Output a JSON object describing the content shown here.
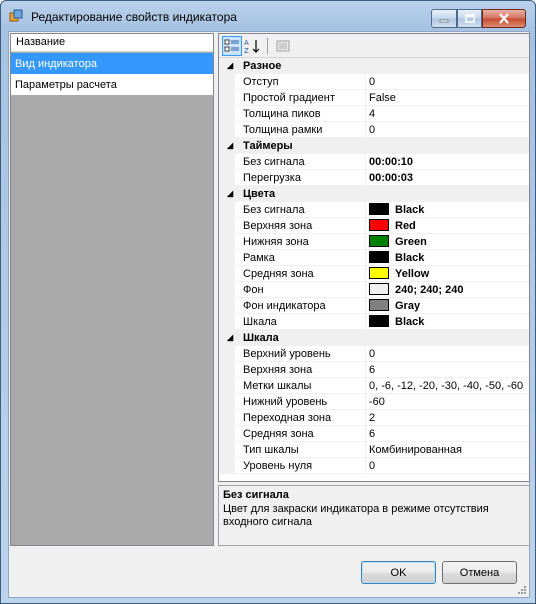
{
  "window": {
    "title": "Редактирование свойств индикатора"
  },
  "left_list": {
    "header": "Название",
    "items": [
      "Вид индикатора",
      "Параметры расчета"
    ]
  },
  "categories": [
    {
      "name": "Разное",
      "props": [
        {
          "name": "Отступ",
          "value": "0"
        },
        {
          "name": "Простой градиент",
          "value": "False"
        },
        {
          "name": "Толщина пиков",
          "value": "4"
        },
        {
          "name": "Толщина рамки",
          "value": "0"
        }
      ]
    },
    {
      "name": "Таймеры",
      "props": [
        {
          "name": "Без сигнала",
          "value": "00:00:10"
        },
        {
          "name": "Перегрузка",
          "value": "00:00:03"
        }
      ]
    },
    {
      "name": "Цвета",
      "props": [
        {
          "name": "Без сигнала",
          "value": "Black",
          "color": "#000000"
        },
        {
          "name": "Верхняя зона",
          "value": "Red",
          "color": "#ff0000"
        },
        {
          "name": "Нижняя зона",
          "value": "Green",
          "color": "#008000"
        },
        {
          "name": "Рамка",
          "value": "Black",
          "color": "#000000"
        },
        {
          "name": "Средняя зона",
          "value": "Yellow",
          "color": "#ffff00"
        },
        {
          "name": "Фон",
          "value": "240; 240; 240",
          "color": "#f0f0f0"
        },
        {
          "name": "Фон индикатора",
          "value": "Gray",
          "color": "#808080"
        },
        {
          "name": "Шкала",
          "value": "Black",
          "color": "#000000"
        }
      ]
    },
    {
      "name": "Шкала",
      "props": [
        {
          "name": "Верхний уровень",
          "value": "0"
        },
        {
          "name": "Верхняя зона",
          "value": "6"
        },
        {
          "name": "Метки шкалы",
          "value": "0, -6, -12, -20, -30, -40, -50, -60"
        },
        {
          "name": "Нижний уровень",
          "value": "-60"
        },
        {
          "name": "Переходная зона",
          "value": "2"
        },
        {
          "name": "Средняя зона",
          "value": "6"
        },
        {
          "name": "Тип шкалы",
          "value": "Комбинированная"
        },
        {
          "name": "Уровень нуля",
          "value": "0"
        }
      ]
    }
  ],
  "help": {
    "title": "Без сигнала",
    "description": "Цвет для закраски индикатора в режиме отсутствия входного сигнала"
  },
  "buttons": {
    "ok": "OK",
    "cancel": "Отмена"
  },
  "colors": {
    "selection": "#3399ff",
    "category_bg": "#f0f0f0"
  }
}
